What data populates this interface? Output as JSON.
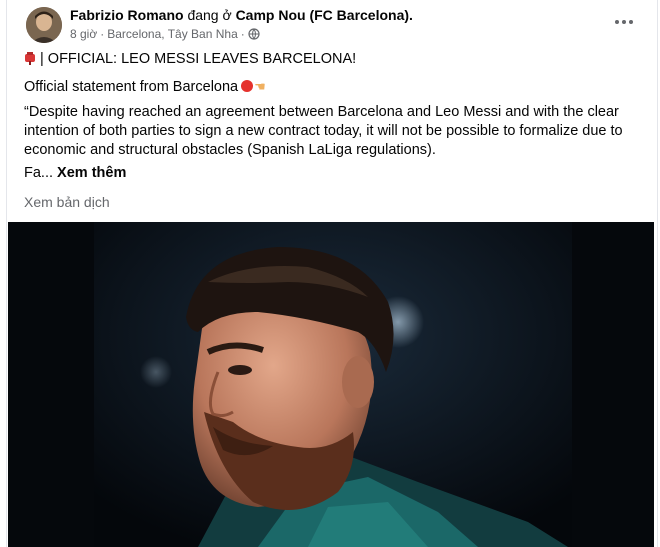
{
  "header": {
    "author": "Fabrizio Romano",
    "connector": " đang ở ",
    "location": "Camp Nou (FC Barcelona).",
    "time": "8 giờ",
    "separator": "·",
    "place": "Barcelona, Tây Ban Nha",
    "separator2": "·",
    "privacy_icon": "globe-icon",
    "more_icon": "more-horizontal-icon"
  },
  "post": {
    "headline": "| OFFICIAL: LEO MESSI LEAVES BARCELONA!",
    "statement": "Official statement from Barcelona",
    "quote": "“Despite having reached an agreement between Barcelona and Leo Messi and with the clear intention of both parties to sign a new contract today, it will not be possible to formalize due to economic and structural obstacles (Spanish LaLiga regulations).",
    "truncated": "Fa...",
    "see_more": "Xem thêm",
    "translate": "Xem bản dịch"
  },
  "colors": {
    "text": "#050505",
    "secondary": "#65676b",
    "photo_bg": "#06090e",
    "jersey": "#1f7a7a"
  }
}
